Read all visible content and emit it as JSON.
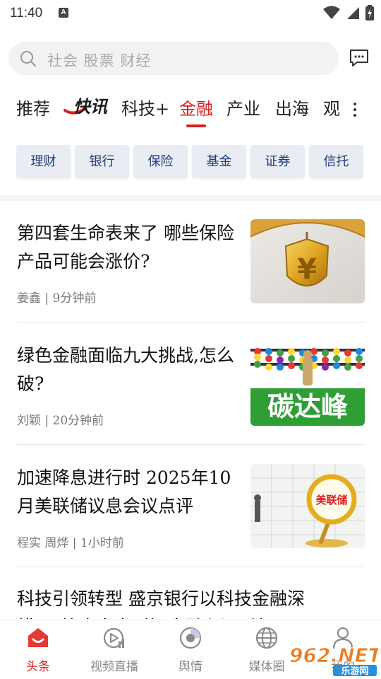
{
  "status": {
    "time": "11:40",
    "notif_icon": "A"
  },
  "search": {
    "placeholder": "社会 股票 财经"
  },
  "channels": [
    {
      "label": "推荐",
      "active": false
    },
    {
      "label": "快讯",
      "logo": true
    },
    {
      "label": "科技+",
      "active": false
    },
    {
      "label": "金融",
      "active": true
    },
    {
      "label": "产业",
      "active": false
    },
    {
      "label": "出海",
      "active": false
    },
    {
      "label": "观",
      "active": false
    }
  ],
  "chips": [
    "理财",
    "银行",
    "保险",
    "基金",
    "证券",
    "信托"
  ],
  "articles": [
    {
      "title": "第四套生命表来了 哪些保险产品可能会涨价?",
      "meta": "姜鑫 | 9分钟前",
      "thumb": "golden-yuan-shield-umbrella"
    },
    {
      "title": "绿色金融面临九大挑战,怎么破?",
      "meta": "刘颖 | 20分钟前",
      "thumb": "abacus-carbon-peak",
      "thumb_text": "碳达峰"
    },
    {
      "title": "加速降息进行时 2025年10月美联储议息会议点评",
      "meta": "程实 周烨 | 1小时前",
      "thumb": "magnifier-fed",
      "thumb_text": "美联储"
    },
    {
      "title": "科技引领转型 盛京银行以科技金融深耕“五篇大文章”著“金融兴辽”科",
      "meta": ""
    }
  ],
  "bottom_nav": [
    {
      "label": "头条",
      "icon": "home-icon",
      "active": true
    },
    {
      "label": "视频直播",
      "icon": "video-live-icon",
      "active": false
    },
    {
      "label": "舆情",
      "icon": "sentiment-icon",
      "active": false
    },
    {
      "label": "媒体圈",
      "icon": "globe-icon",
      "active": false
    },
    {
      "label": "我的",
      "icon": "profile-icon",
      "active": false
    }
  ],
  "watermark": {
    "text": "962.NET",
    "sub": "乐游网"
  },
  "colors": {
    "accent": "#d71f1f",
    "chip_bg": "#e9ecf3",
    "chip_text": "#1f3c78"
  }
}
